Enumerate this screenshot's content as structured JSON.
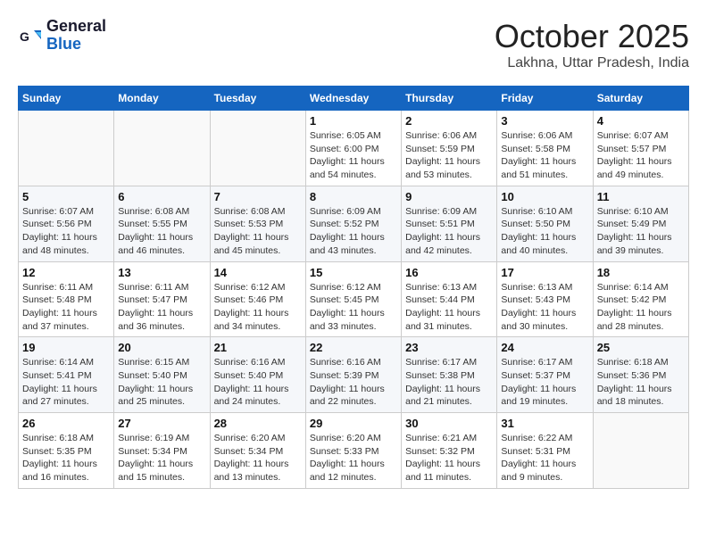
{
  "header": {
    "logo_line1": "General",
    "logo_line2": "Blue",
    "month": "October 2025",
    "location": "Lakhna, Uttar Pradesh, India"
  },
  "weekdays": [
    "Sunday",
    "Monday",
    "Tuesday",
    "Wednesday",
    "Thursday",
    "Friday",
    "Saturday"
  ],
  "weeks": [
    [
      {
        "day": "",
        "info": ""
      },
      {
        "day": "",
        "info": ""
      },
      {
        "day": "",
        "info": ""
      },
      {
        "day": "1",
        "info": "Sunrise: 6:05 AM\nSunset: 6:00 PM\nDaylight: 11 hours\nand 54 minutes."
      },
      {
        "day": "2",
        "info": "Sunrise: 6:06 AM\nSunset: 5:59 PM\nDaylight: 11 hours\nand 53 minutes."
      },
      {
        "day": "3",
        "info": "Sunrise: 6:06 AM\nSunset: 5:58 PM\nDaylight: 11 hours\nand 51 minutes."
      },
      {
        "day": "4",
        "info": "Sunrise: 6:07 AM\nSunset: 5:57 PM\nDaylight: 11 hours\nand 49 minutes."
      }
    ],
    [
      {
        "day": "5",
        "info": "Sunrise: 6:07 AM\nSunset: 5:56 PM\nDaylight: 11 hours\nand 48 minutes."
      },
      {
        "day": "6",
        "info": "Sunrise: 6:08 AM\nSunset: 5:55 PM\nDaylight: 11 hours\nand 46 minutes."
      },
      {
        "day": "7",
        "info": "Sunrise: 6:08 AM\nSunset: 5:53 PM\nDaylight: 11 hours\nand 45 minutes."
      },
      {
        "day": "8",
        "info": "Sunrise: 6:09 AM\nSunset: 5:52 PM\nDaylight: 11 hours\nand 43 minutes."
      },
      {
        "day": "9",
        "info": "Sunrise: 6:09 AM\nSunset: 5:51 PM\nDaylight: 11 hours\nand 42 minutes."
      },
      {
        "day": "10",
        "info": "Sunrise: 6:10 AM\nSunset: 5:50 PM\nDaylight: 11 hours\nand 40 minutes."
      },
      {
        "day": "11",
        "info": "Sunrise: 6:10 AM\nSunset: 5:49 PM\nDaylight: 11 hours\nand 39 minutes."
      }
    ],
    [
      {
        "day": "12",
        "info": "Sunrise: 6:11 AM\nSunset: 5:48 PM\nDaylight: 11 hours\nand 37 minutes."
      },
      {
        "day": "13",
        "info": "Sunrise: 6:11 AM\nSunset: 5:47 PM\nDaylight: 11 hours\nand 36 minutes."
      },
      {
        "day": "14",
        "info": "Sunrise: 6:12 AM\nSunset: 5:46 PM\nDaylight: 11 hours\nand 34 minutes."
      },
      {
        "day": "15",
        "info": "Sunrise: 6:12 AM\nSunset: 5:45 PM\nDaylight: 11 hours\nand 33 minutes."
      },
      {
        "day": "16",
        "info": "Sunrise: 6:13 AM\nSunset: 5:44 PM\nDaylight: 11 hours\nand 31 minutes."
      },
      {
        "day": "17",
        "info": "Sunrise: 6:13 AM\nSunset: 5:43 PM\nDaylight: 11 hours\nand 30 minutes."
      },
      {
        "day": "18",
        "info": "Sunrise: 6:14 AM\nSunset: 5:42 PM\nDaylight: 11 hours\nand 28 minutes."
      }
    ],
    [
      {
        "day": "19",
        "info": "Sunrise: 6:14 AM\nSunset: 5:41 PM\nDaylight: 11 hours\nand 27 minutes."
      },
      {
        "day": "20",
        "info": "Sunrise: 6:15 AM\nSunset: 5:40 PM\nDaylight: 11 hours\nand 25 minutes."
      },
      {
        "day": "21",
        "info": "Sunrise: 6:16 AM\nSunset: 5:40 PM\nDaylight: 11 hours\nand 24 minutes."
      },
      {
        "day": "22",
        "info": "Sunrise: 6:16 AM\nSunset: 5:39 PM\nDaylight: 11 hours\nand 22 minutes."
      },
      {
        "day": "23",
        "info": "Sunrise: 6:17 AM\nSunset: 5:38 PM\nDaylight: 11 hours\nand 21 minutes."
      },
      {
        "day": "24",
        "info": "Sunrise: 6:17 AM\nSunset: 5:37 PM\nDaylight: 11 hours\nand 19 minutes."
      },
      {
        "day": "25",
        "info": "Sunrise: 6:18 AM\nSunset: 5:36 PM\nDaylight: 11 hours\nand 18 minutes."
      }
    ],
    [
      {
        "day": "26",
        "info": "Sunrise: 6:18 AM\nSunset: 5:35 PM\nDaylight: 11 hours\nand 16 minutes."
      },
      {
        "day": "27",
        "info": "Sunrise: 6:19 AM\nSunset: 5:34 PM\nDaylight: 11 hours\nand 15 minutes."
      },
      {
        "day": "28",
        "info": "Sunrise: 6:20 AM\nSunset: 5:34 PM\nDaylight: 11 hours\nand 13 minutes."
      },
      {
        "day": "29",
        "info": "Sunrise: 6:20 AM\nSunset: 5:33 PM\nDaylight: 11 hours\nand 12 minutes."
      },
      {
        "day": "30",
        "info": "Sunrise: 6:21 AM\nSunset: 5:32 PM\nDaylight: 11 hours\nand 11 minutes."
      },
      {
        "day": "31",
        "info": "Sunrise: 6:22 AM\nSunset: 5:31 PM\nDaylight: 11 hours\nand 9 minutes."
      },
      {
        "day": "",
        "info": ""
      }
    ]
  ]
}
